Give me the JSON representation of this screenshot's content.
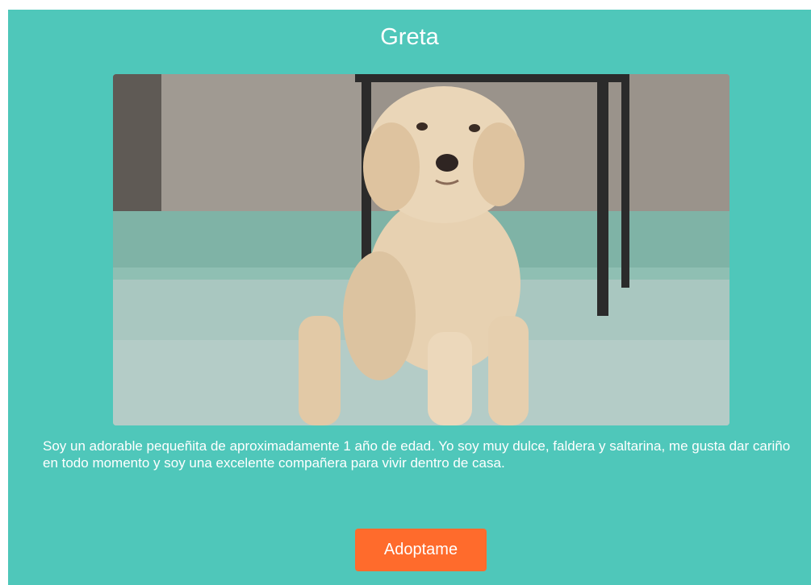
{
  "pet": {
    "name": "Greta",
    "photo_icon": "dog-photo",
    "description": "Soy un adorable pequeñita de aproximadamente 1 año de edad. Yo soy muy dulce, faldera y saltarina, me gusta dar cariño en todo momento y soy una excelente compañera para vivir dentro de casa."
  },
  "actions": {
    "adopt_label": "Adoptame"
  },
  "colors": {
    "card_background": "#4fc7ba",
    "button_background": "#ff6b2c",
    "text": "#ffffff"
  }
}
